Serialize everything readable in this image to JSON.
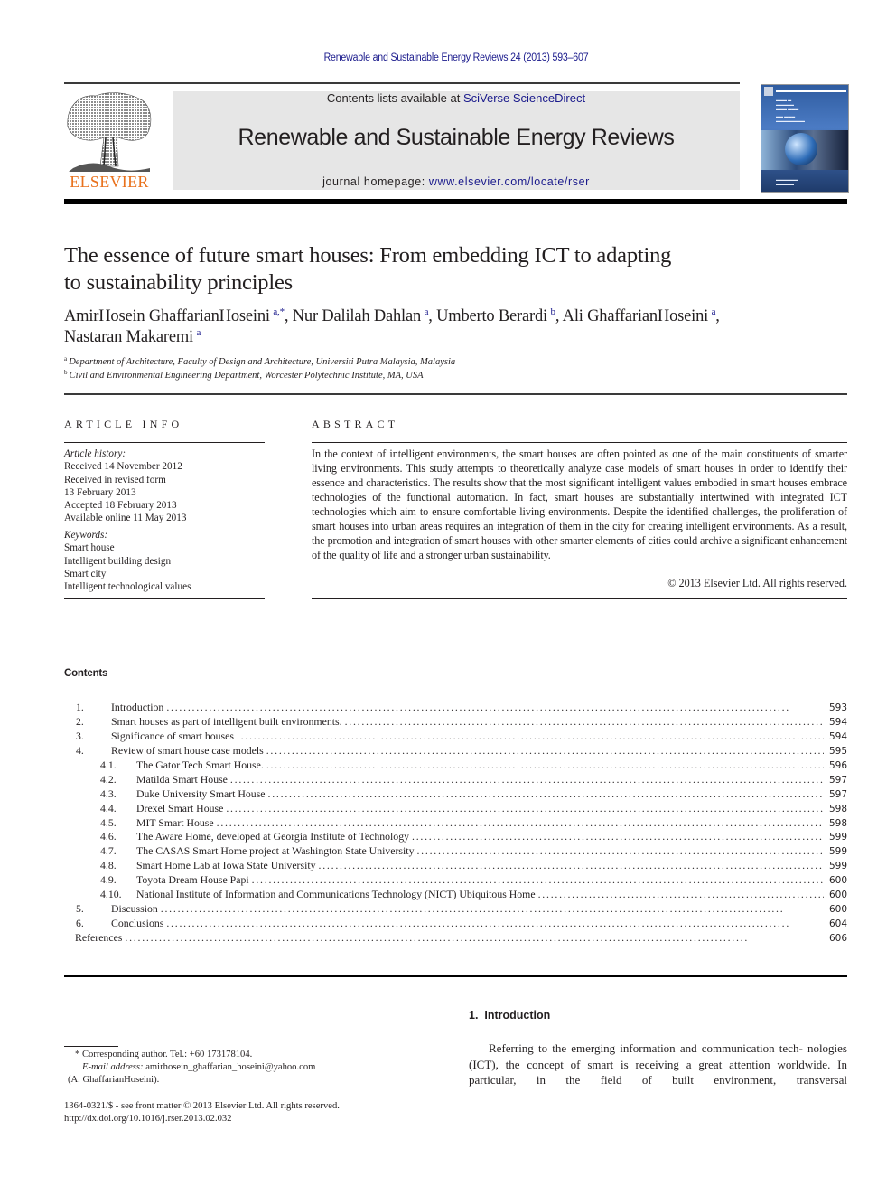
{
  "header": {
    "citation": "Renewable and Sustainable Energy Reviews 24 (2013) 593–607",
    "contents_prefix": "Contents lists available at ",
    "contents_link": "SciVerse ScienceDirect",
    "journal_title": "Renewable and Sustainable Energy Reviews",
    "homepage_prefix": "journal homepage: ",
    "homepage_link": "www.elsevier.com/locate/rser",
    "publisher_logo_text": "ELSEVIER",
    "colors": {
      "link": "#1a1a8c",
      "logo": "#e9711c",
      "box": "#e6e6e6"
    }
  },
  "article": {
    "title_line1": "The essence of future smart houses: From embedding ICT to adapting",
    "title_line2": "to sustainability principles",
    "authors": [
      {
        "name": "AmirHosein GhaffarianHoseini",
        "sup": "a,*",
        "sep": ", "
      },
      {
        "name": "Nur Dalilah Dahlan",
        "sup": "a",
        "sep": ", "
      },
      {
        "name": "Umberto Berardi",
        "sup": "b",
        "sep": ", "
      },
      {
        "name": "Ali GhaffarianHoseini",
        "sup": "a",
        "sep": ","
      },
      {
        "name": "Nastaran Makaremi",
        "sup": "a",
        "sep": ""
      }
    ],
    "affiliations": [
      {
        "sup": "a",
        "text": "Department of Architecture, Faculty of Design and Architecture, Universiti Putra Malaysia, Malaysia"
      },
      {
        "sup": "b",
        "text": "Civil and Environmental Engineering Department, Worcester Polytechnic Institute, MA, USA"
      }
    ]
  },
  "article_info": {
    "heading": "ARTICLE INFO",
    "history_label": "Article history:",
    "history": [
      "Received 14 November 2012",
      "Received in revised form",
      "13 February 2013",
      "Accepted 18 February 2013",
      "Available online 11 May 2013"
    ],
    "keywords_label": "Keywords:",
    "keywords": [
      "Smart house",
      "Intelligent building design",
      "Smart city",
      "Intelligent technological values"
    ]
  },
  "abstract": {
    "heading": "ABSTRACT",
    "text": "In the context of intelligent environments, the smart houses are often pointed as one of the main constituents of smarter living environments. This study attempts to theoretically analyze case models of smart houses in order to identify their essence and characteristics. The results show that the most significant intelligent values embodied in smart houses embrace technologies of the functional automation. In fact, smart houses are substantially intertwined with integrated ICT technologies which aim to ensure comfortable living environments. Despite the identified challenges, the proliferation of smart houses into urban areas requires an integration of them in the city for creating intelligent environments. As a result, the promotion and integration of smart houses with other smarter elements of cities could archive a significant enhancement of the quality of life and a stronger urban sustainability.",
    "copyright": "© 2013 Elsevier Ltd. All rights reserved."
  },
  "contents": {
    "heading": "Contents",
    "items": [
      {
        "level": 1,
        "num": "1.",
        "label": "Introduction",
        "page": "593"
      },
      {
        "level": 1,
        "num": "2.",
        "label": "Smart houses as part of intelligent built environments.",
        "page": "594"
      },
      {
        "level": 1,
        "num": "3.",
        "label": "Significance of smart houses",
        "page": "594"
      },
      {
        "level": 1,
        "num": "4.",
        "label": "Review of smart house case models",
        "page": "595"
      },
      {
        "level": 2,
        "num": "4.1.",
        "label": "The Gator Tech Smart House.",
        "page": "596"
      },
      {
        "level": 2,
        "num": "4.2.",
        "label": "Matilda Smart House",
        "page": "597"
      },
      {
        "level": 2,
        "num": "4.3.",
        "label": "Duke University Smart House",
        "page": "597"
      },
      {
        "level": 2,
        "num": "4.4.",
        "label": "Drexel Smart House",
        "page": "598"
      },
      {
        "level": 2,
        "num": "4.5.",
        "label": "MIT Smart House",
        "page": "598"
      },
      {
        "level": 2,
        "num": "4.6.",
        "label": "The Aware Home, developed at Georgia Institute of Technology",
        "page": "599"
      },
      {
        "level": 2,
        "num": "4.7.",
        "label": "The CASAS Smart Home project at Washington State University",
        "page": "599"
      },
      {
        "level": 2,
        "num": "4.8.",
        "label": "Smart Home Lab at Iowa State University",
        "page": "599"
      },
      {
        "level": 2,
        "num": "4.9.",
        "label": "Toyota Dream House Papi",
        "page": "600"
      },
      {
        "level": 2,
        "num": "4.10.",
        "label": "National Institute of Information and Communications Technology (NICT) Ubiquitous Home",
        "page": "600"
      },
      {
        "level": 1,
        "num": "5.",
        "label": "Discussion",
        "page": "600"
      },
      {
        "level": 1,
        "num": "6.",
        "label": "Conclusions",
        "page": "604"
      },
      {
        "level": 0,
        "num": "",
        "label": "References",
        "page": "606"
      }
    ]
  },
  "footnotes": {
    "corresponding": "* Corresponding author. Tel.: +60 173178104.",
    "email_label": "E-mail address:",
    "email": "amirhosein_ghaffarian_hoseini@yahoo.com",
    "email_owner": "(A. GhaffarianHoseini).",
    "issn_line": "1364-0321/$ - see front matter © 2013 Elsevier Ltd. All rights reserved.",
    "doi": "http://dx.doi.org/10.1016/j.rser.2013.02.032"
  },
  "introduction": {
    "heading": "1.  Introduction",
    "text": "Referring to the emerging information and communication tech- nologies (ICT), the concept of smart is receiving a great attention worldwide. In particular, in the field of built environment, transversal"
  }
}
